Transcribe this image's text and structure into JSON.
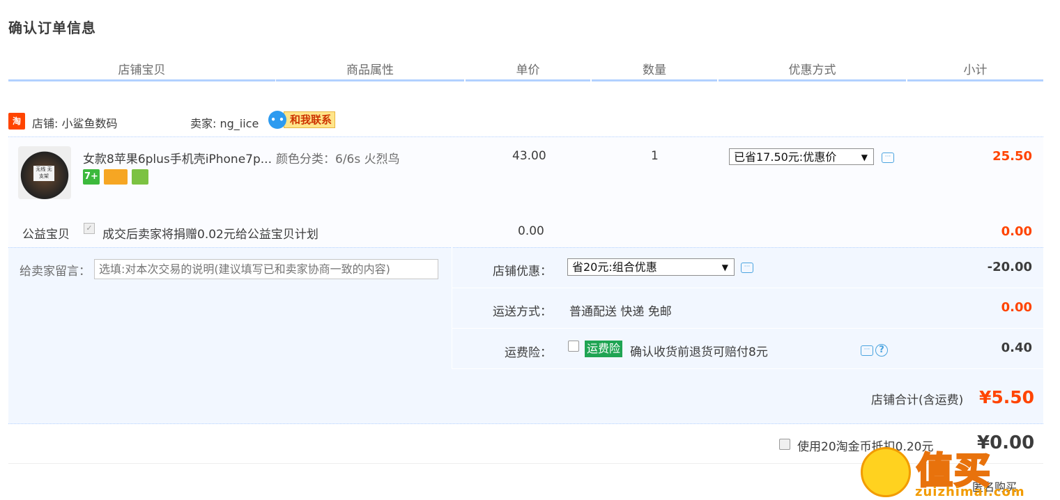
{
  "page_title": "确认订单信息",
  "columns": [
    "店铺宝贝",
    "商品属性",
    "单价",
    "数量",
    "优惠方式",
    "小计"
  ],
  "shop": {
    "icon_text": "淘",
    "shop_label": "店铺: 小鲨鱼数码",
    "seller_label": "卖家: ng_iice",
    "chat_label": "和我联系",
    "chat_icon": "chat-bubble-icon"
  },
  "item": {
    "name": "女款8苹果6plus手机壳iPhone7p...",
    "image_tag": "无线 无支架",
    "badges": [
      "7+",
      "card",
      "service"
    ],
    "attr": "颜色分类：6/6s 火烈鸟",
    "price": "43.00",
    "quantity": "1",
    "promo_selected": "已省17.50元:优惠价",
    "subtotal": "25.50"
  },
  "charity": {
    "label": "公益宝贝",
    "text": "成交后卖家将捐赠0.02元给公益宝贝计划",
    "price": "0.00",
    "subtotal": "0.00"
  },
  "message": {
    "label": "给卖家留言：",
    "placeholder": "选填:对本次交易的说明(建议填写已和卖家协商一致的内容)"
  },
  "shop_discount": {
    "label": "店铺优惠：",
    "selected": "省20元:组合优惠",
    "amount": "-20.00"
  },
  "shipping": {
    "label": "运送方式：",
    "value": "普通配送 快递 免邮",
    "amount": "0.00"
  },
  "insurance": {
    "label": "运费险：",
    "tag": "运费险",
    "text": "确认收货前退货可赔付8元",
    "amount": "0.40"
  },
  "shop_total": {
    "label": "店铺合计(含运费)",
    "value": "¥5.50"
  },
  "coins": {
    "text": "使用20淘金币抵扣0.20元",
    "total": "¥0.00"
  },
  "anonymous": "匿名购买",
  "watermark": {
    "text": "值买",
    "url": "zuizhimai.com"
  },
  "colors": {
    "accent_orange": "#ff4400",
    "header_line": "#b2d1ff",
    "insurance_green": "#1fa453"
  }
}
